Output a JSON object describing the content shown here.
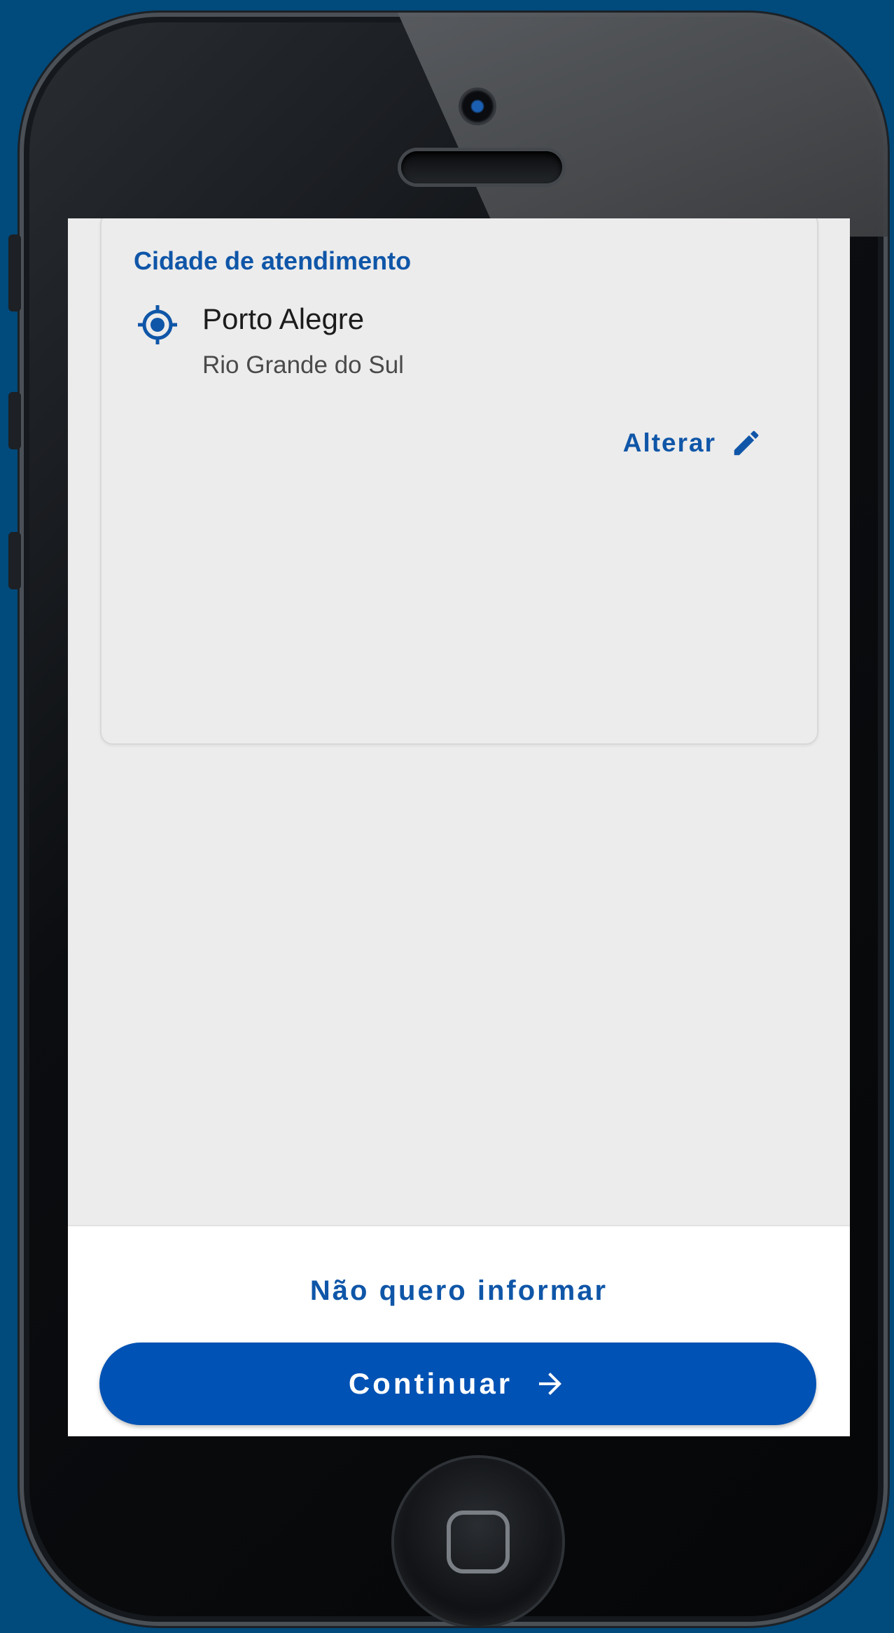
{
  "colors": {
    "accent": "#0f56a8",
    "button": "#0052b4",
    "screen_bg": "#ececec",
    "page_bg": "#004a7c"
  },
  "card": {
    "title": "Cidade de atendimento",
    "city": "Porto Alegre",
    "state": "Rio  Grande do Sul",
    "location_icon": "target-location-icon",
    "edit_label": "Alterar",
    "edit_icon": "pencil-icon"
  },
  "footer": {
    "skip_label": "Não quero informar",
    "continue_label": "Continuar",
    "continue_icon": "arrow-right-icon"
  }
}
